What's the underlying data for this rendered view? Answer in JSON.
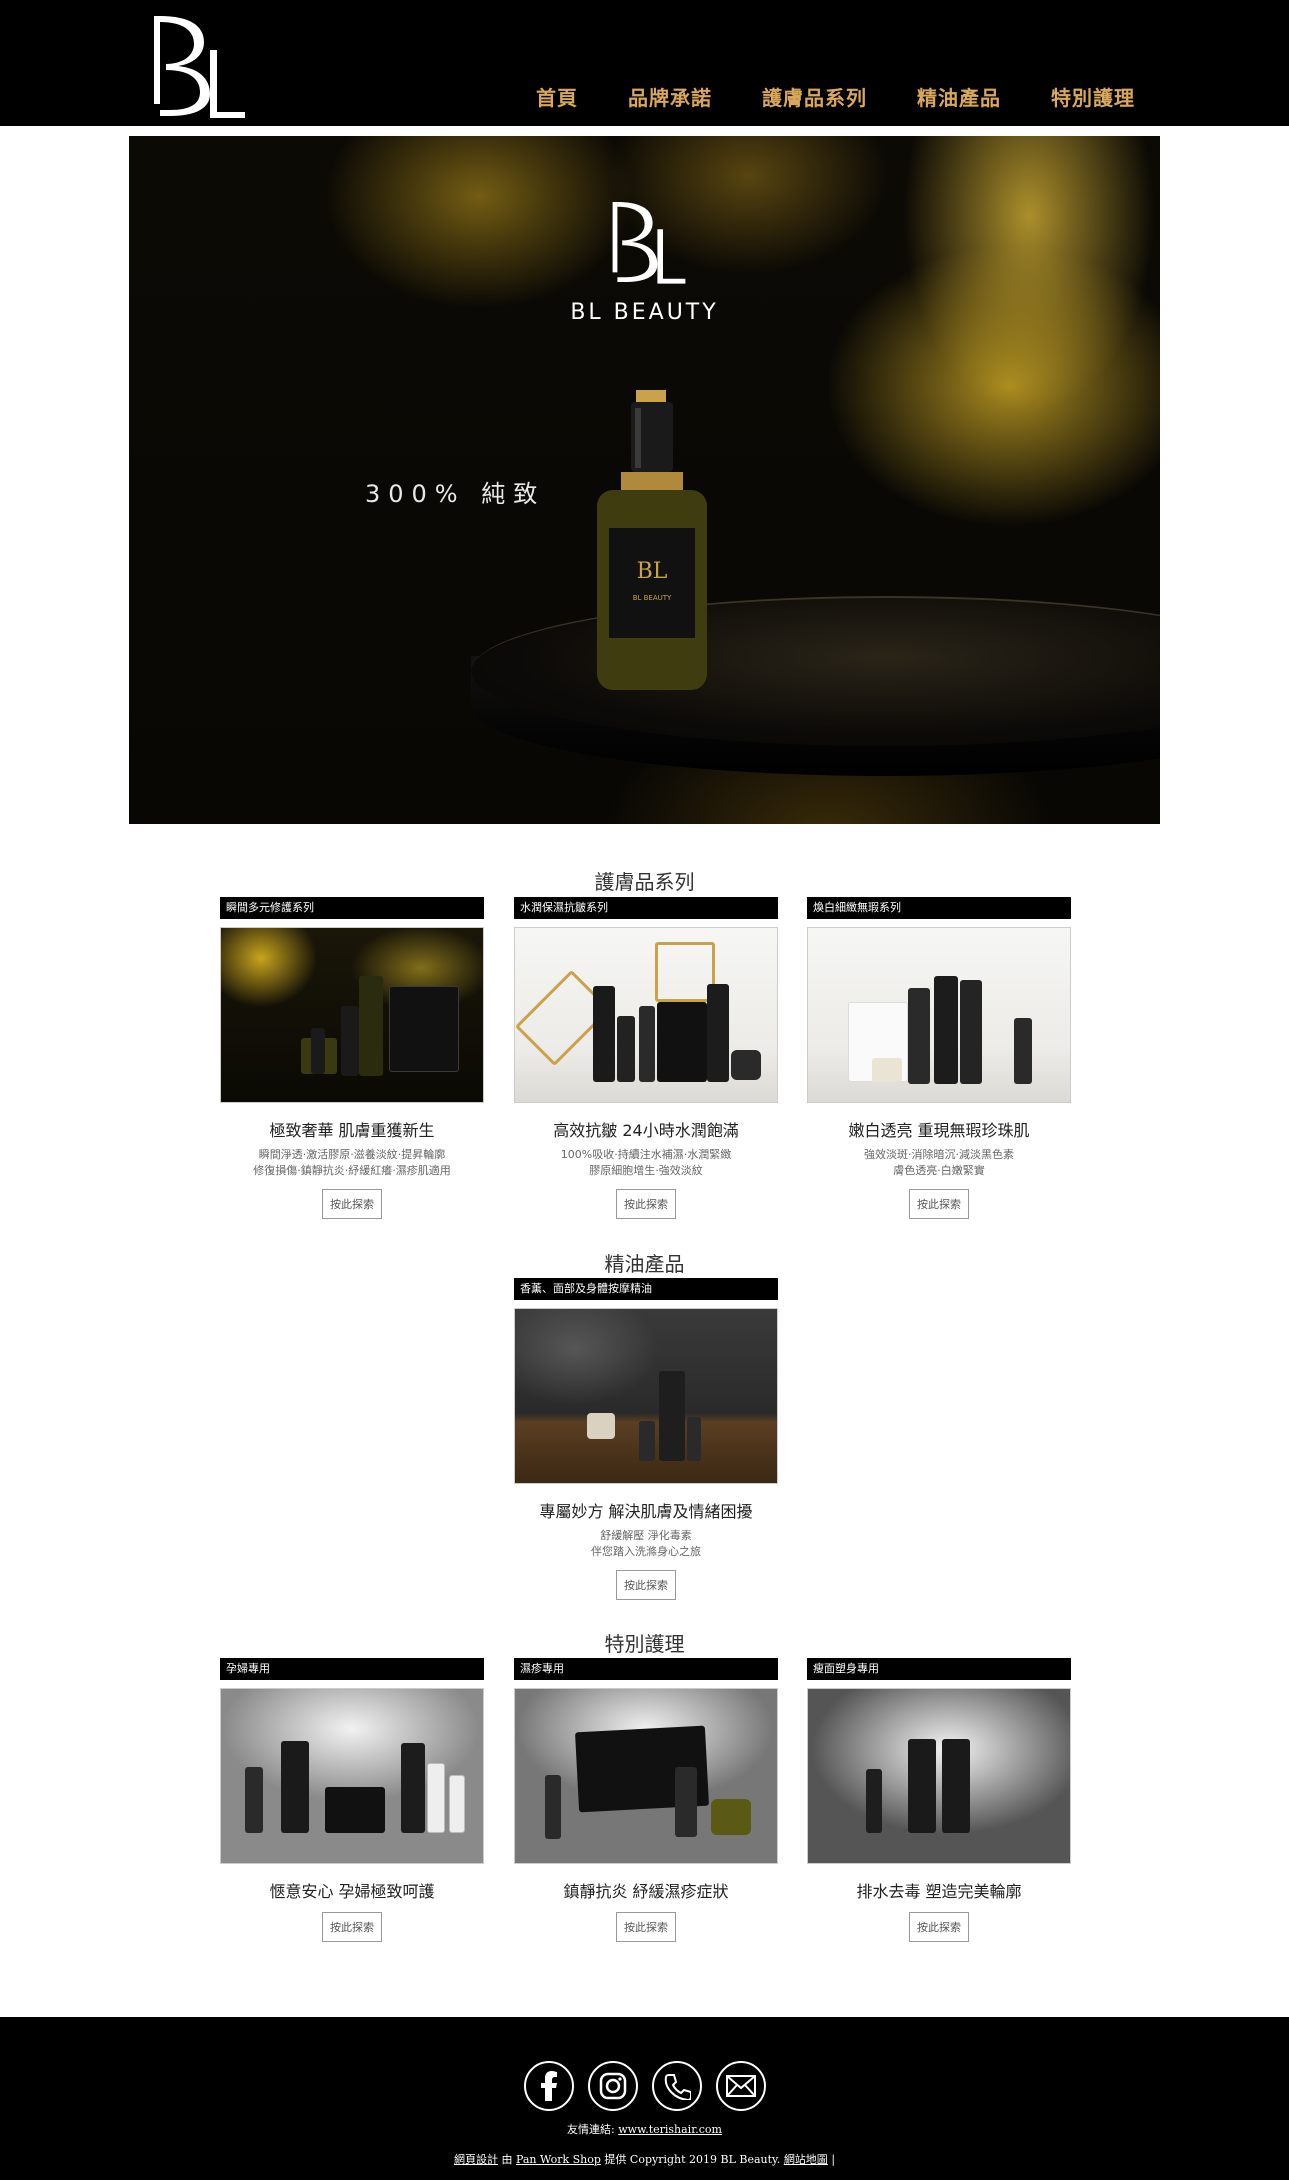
{
  "header": {
    "nav": [
      "首頁",
      "品牌承諾",
      "護膚品系列",
      "精油產品",
      "特別護理"
    ]
  },
  "hero": {
    "brand_name": "BL BEAUTY",
    "tagline": "300% 純致"
  },
  "skincare": {
    "title": "護膚品系列",
    "cards": [
      {
        "bar": "瞬間多元修護系列",
        "heading": "極致奢華 肌膚重獲新生",
        "desc1": "瞬間淨透·激活膠原·滋養淡紋·提昇輪廓",
        "desc2": "修復損傷·鎮靜抗炎·紓緩紅癢·濕疹肌適用",
        "button": "按此探索"
      },
      {
        "bar": "水潤保濕抗皺系列",
        "heading": "高效抗皺 24小時水潤飽滿",
        "desc1": "100%吸收·持續注水補濕·水潤緊緻",
        "desc2": "膠原細胞增生·強效淡紋",
        "button": "按此探索"
      },
      {
        "bar": "煥白細緻無瑕系列",
        "heading": "嫩白透亮 重現無瑕珍珠肌",
        "desc1": "強效淡斑·消除暗沉·減淡黑色素",
        "desc2": "膚色透亮·白嫩緊實",
        "button": "按此探索"
      }
    ]
  },
  "oils": {
    "title": "精油產品",
    "card": {
      "bar": "香薰、面部及身體按摩精油",
      "heading": "專屬妙方 解決肌膚及情緒困擾",
      "desc1": "舒緩解壓 淨化毒素",
      "desc2": "伴您踏入洗滌身心之旅",
      "button": "按此探索"
    }
  },
  "special": {
    "title": "特別護理",
    "cards": [
      {
        "bar": "孕婦專用",
        "heading": "愜意安心 孕婦極致呵護",
        "button": "按此探索"
      },
      {
        "bar": "濕疹專用",
        "heading": "鎮靜抗炎 紓緩濕疹症狀",
        "button": "按此探索"
      },
      {
        "bar": "瘦面塑身專用",
        "heading": "排水去毒 塑造完美輪廓",
        "button": "按此探索"
      }
    ]
  },
  "footer": {
    "socials": [
      "facebook-icon",
      "instagram-icon",
      "phone-icon",
      "mail-icon"
    ],
    "links_label": "友情連結:",
    "links_url": "www.terishair.com",
    "credit_design": "網頁設計",
    "credit_by": "由",
    "credit_provider": "Pan Work Shop",
    "credit_text": "提供 Copyright 2019 BL Beauty.",
    "sitemap": "網站地圖",
    "sep": "|"
  },
  "colors": {
    "nav": "#d9a85c",
    "header_bg": "#000000",
    "footer_bg": "#000000"
  }
}
